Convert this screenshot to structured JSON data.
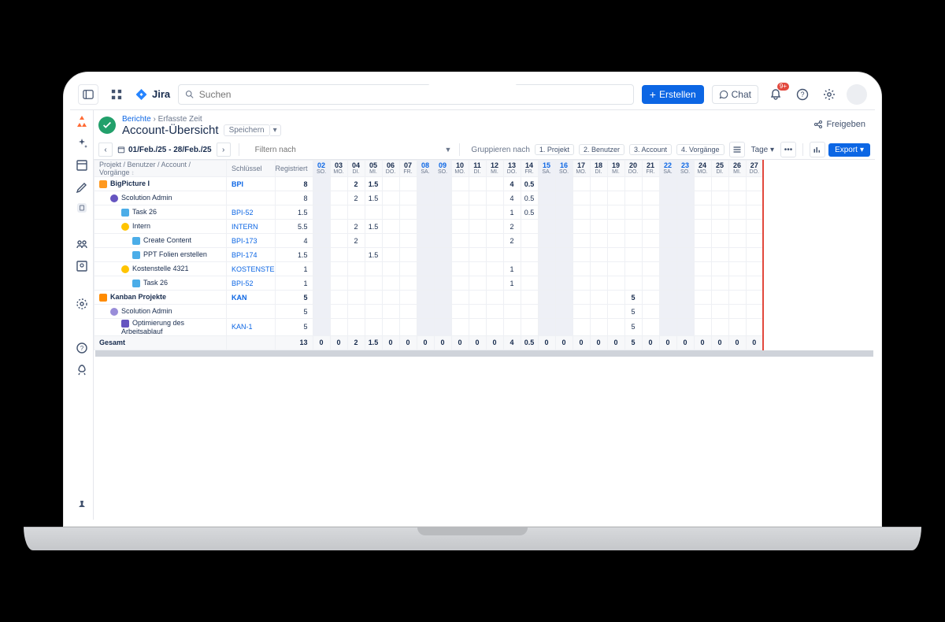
{
  "top": {
    "brand": "Jira",
    "search_placeholder": "Suchen",
    "create": "Erstellen",
    "chat": "Chat",
    "notif_badge": "9+"
  },
  "breadcrumb": {
    "a": "Berichte",
    "b": "Erfasste Zeit"
  },
  "page_title": "Account-Übersicht",
  "save": "Speichern",
  "share": "Freigeben",
  "daterange": "01/Feb./25 - 28/Feb./25",
  "filter_placeholder": "Filtern nach",
  "group_label": "Gruppieren nach",
  "groups": [
    "1. Projekt",
    "2. Benutzer",
    "3. Account",
    "4. Vorgänge"
  ],
  "view_label": "Tage",
  "export": "Export",
  "columns": {
    "name": "Projekt / Benutzer / Account / Vorgänge",
    "key": "Schlüssel",
    "reg": "Registriert"
  },
  "days": [
    {
      "n": "02",
      "d": "SO.",
      "w": true
    },
    {
      "n": "03",
      "d": "MO."
    },
    {
      "n": "04",
      "d": "DI."
    },
    {
      "n": "05",
      "d": "MI."
    },
    {
      "n": "06",
      "d": "DO."
    },
    {
      "n": "07",
      "d": "FR."
    },
    {
      "n": "08",
      "d": "SA.",
      "w": true
    },
    {
      "n": "09",
      "d": "SO.",
      "w": true
    },
    {
      "n": "10",
      "d": "MO."
    },
    {
      "n": "11",
      "d": "DI."
    },
    {
      "n": "12",
      "d": "MI."
    },
    {
      "n": "13",
      "d": "DO."
    },
    {
      "n": "14",
      "d": "FR."
    },
    {
      "n": "15",
      "d": "SA.",
      "w": true
    },
    {
      "n": "16",
      "d": "SO.",
      "w": true
    },
    {
      "n": "17",
      "d": "MO."
    },
    {
      "n": "18",
      "d": "DI."
    },
    {
      "n": "19",
      "d": "MI."
    },
    {
      "n": "20",
      "d": "DO."
    },
    {
      "n": "21",
      "d": "FR."
    },
    {
      "n": "22",
      "d": "SA.",
      "w": true
    },
    {
      "n": "23",
      "d": "SO.",
      "w": true
    },
    {
      "n": "24",
      "d": "MO."
    },
    {
      "n": "25",
      "d": "DI."
    },
    {
      "n": "26",
      "d": "MI."
    },
    {
      "n": "27",
      "d": "DO.",
      "today": true
    }
  ],
  "rows": [
    {
      "indent": 0,
      "icon": "proj1",
      "name": "BigPicture I",
      "key": "BPI",
      "reg": "8",
      "bold": true,
      "cells": {
        "2": "2",
        "3": "1.5",
        "11": "4",
        "12": "0.5"
      }
    },
    {
      "indent": 1,
      "icon": "user",
      "name": "Scolution Admin",
      "key": "",
      "reg": "8",
      "cells": {
        "2": "2",
        "3": "1.5",
        "11": "4",
        "12": "0.5"
      }
    },
    {
      "indent": 2,
      "icon": "task",
      "name": "Task 26",
      "key": "BPI-52",
      "reg": "1.5",
      "cells": {
        "11": "1",
        "12": "0.5"
      }
    },
    {
      "indent": 2,
      "icon": "intern",
      "name": "Intern",
      "key": "INTERN",
      "reg": "5.5",
      "cells": {
        "2": "2",
        "3": "1.5",
        "11": "2"
      }
    },
    {
      "indent": 3,
      "icon": "task",
      "name": "Create Content",
      "key": "BPI-173",
      "reg": "4",
      "cells": {
        "2": "2",
        "11": "2"
      }
    },
    {
      "indent": 3,
      "icon": "task",
      "name": "PPT Folien erstellen",
      "key": "BPI-174",
      "reg": "1.5",
      "cells": {
        "3": "1.5"
      }
    },
    {
      "indent": 2,
      "icon": "acc",
      "name": "Kostenstelle 4321",
      "key": "KOSTENSTE",
      "reg": "1",
      "cells": {
        "11": "1"
      }
    },
    {
      "indent": 3,
      "icon": "task",
      "name": "Task 26",
      "key": "BPI-52",
      "reg": "1",
      "cells": {
        "11": "1"
      }
    },
    {
      "indent": 0,
      "icon": "proj2",
      "name": "Kanban Projekte",
      "key": "KAN",
      "reg": "5",
      "bold": true,
      "cells": {
        "18": "5"
      }
    },
    {
      "indent": 1,
      "icon": "user2",
      "name": "Scolution Admin",
      "key": "",
      "reg": "5",
      "cells": {
        "18": "5"
      }
    },
    {
      "indent": 2,
      "icon": "story",
      "name": "Optimierung des Arbeitsablauf",
      "key": "KAN-1",
      "reg": "5",
      "cells": {
        "18": "5"
      }
    }
  ],
  "totals": {
    "label": "Gesamt",
    "reg": "13",
    "cells": [
      "0",
      "0",
      "2",
      "1.5",
      "0",
      "0",
      "0",
      "0",
      "0",
      "0",
      "0",
      "4",
      "0.5",
      "0",
      "0",
      "0",
      "0",
      "0",
      "5",
      "0",
      "0",
      "0",
      "0",
      "0",
      "0",
      "0"
    ]
  }
}
